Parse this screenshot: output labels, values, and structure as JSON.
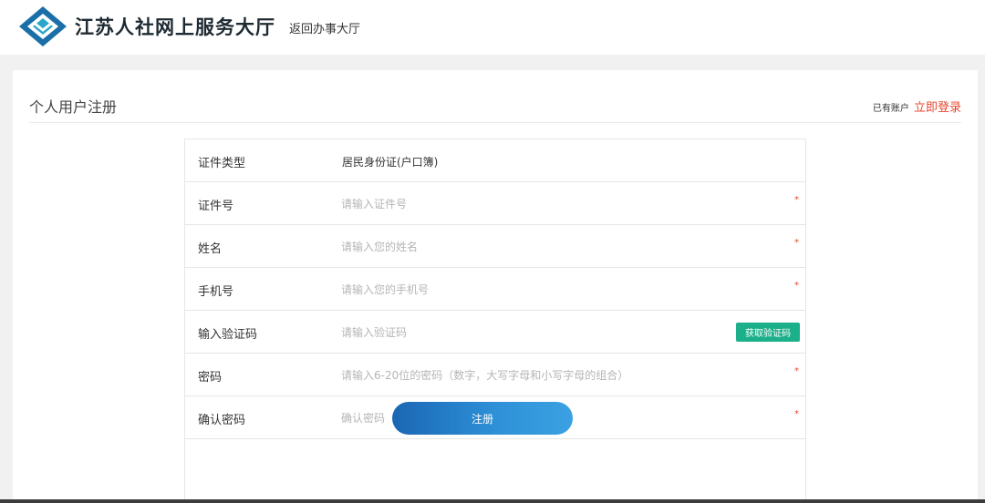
{
  "header": {
    "site_name": "江苏人社网上服务大厅",
    "back_link": "返回办事大厅",
    "logo_icon": "diamond-logo-icon",
    "brand_color": "#1b6fa8"
  },
  "panel": {
    "title": "个人用户注册",
    "login_prefix": "已有账户",
    "login_link": "立即登录"
  },
  "form": {
    "rows": [
      {
        "label": "证件类型",
        "value": "居民身份证(户口簿)"
      },
      {
        "label": "证件号",
        "placeholder": "请输入证件号",
        "required": "*"
      },
      {
        "label": "姓名",
        "placeholder": "请输入您的姓名",
        "required": "*"
      },
      {
        "label": "手机号",
        "placeholder": "请输入您的手机号",
        "required": "*"
      },
      {
        "label": "输入验证码",
        "placeholder": "请输入验证码",
        "action": "获取验证码"
      },
      {
        "label": "密码",
        "placeholder": "请输入6-20位的密码（数字，大写字母和小写字母的组合）",
        "required": "*"
      },
      {
        "label": "确认密码",
        "placeholder": "确认密码",
        "required": "*"
      }
    ],
    "submit_label": "注册"
  },
  "colors": {
    "accent_red": "#e8462e",
    "sms_button_green": "#1bb08a",
    "submit_blue": "#2f92d8"
  }
}
